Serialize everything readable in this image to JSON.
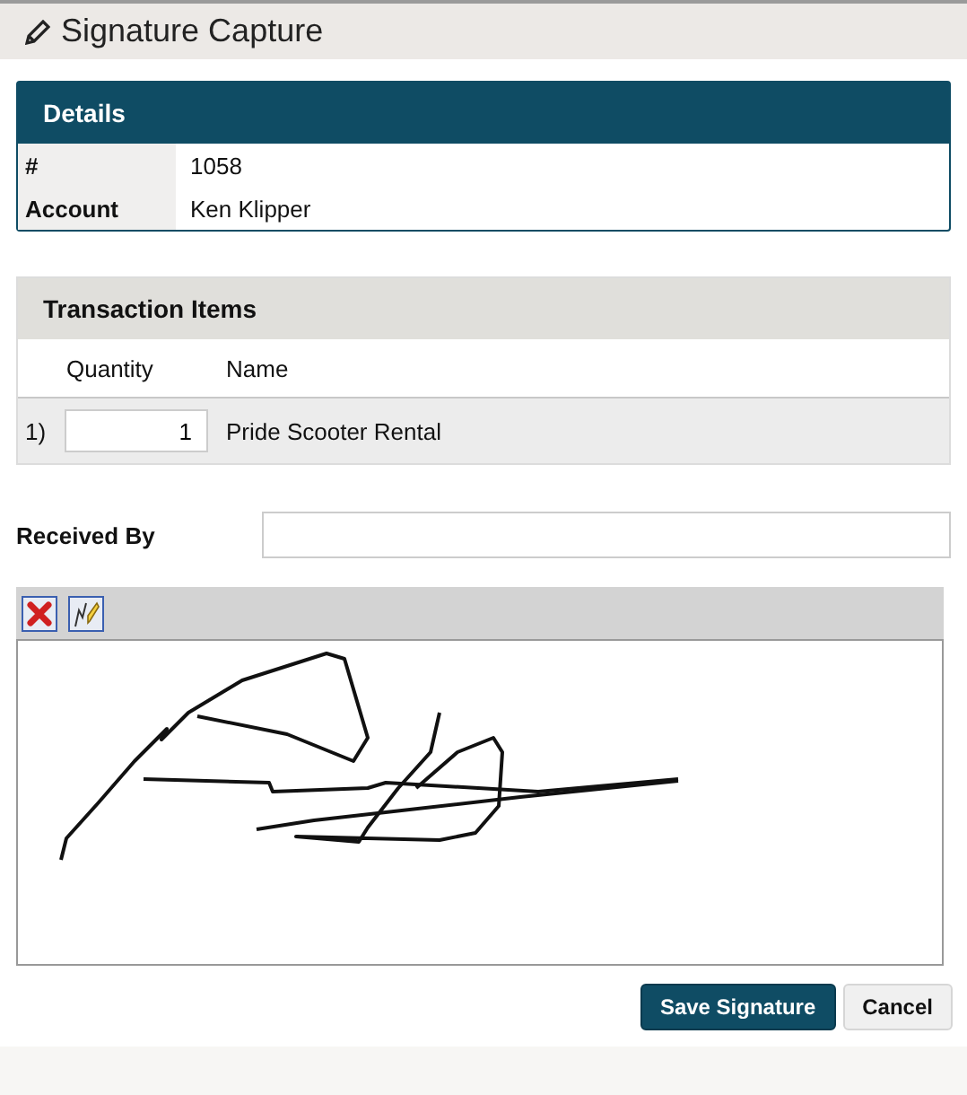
{
  "page_title": "Signature Capture",
  "details": {
    "title": "Details",
    "rows": [
      {
        "label": "#",
        "value": "1058"
      },
      {
        "label": "Account",
        "value": "Ken Klipper"
      }
    ]
  },
  "transaction_items": {
    "title": "Transaction Items",
    "columns": [
      "Quantity",
      "Name"
    ],
    "rows": [
      {
        "index": "1)",
        "quantity": "1",
        "name": "Pride Scooter Rental"
      }
    ]
  },
  "received_by": {
    "label": "Received By"
  },
  "buttons": [
    {
      "label": "Save Signature",
      "kind": "primary"
    },
    {
      "label": "Cancel",
      "kind": "secondary"
    }
  ]
}
